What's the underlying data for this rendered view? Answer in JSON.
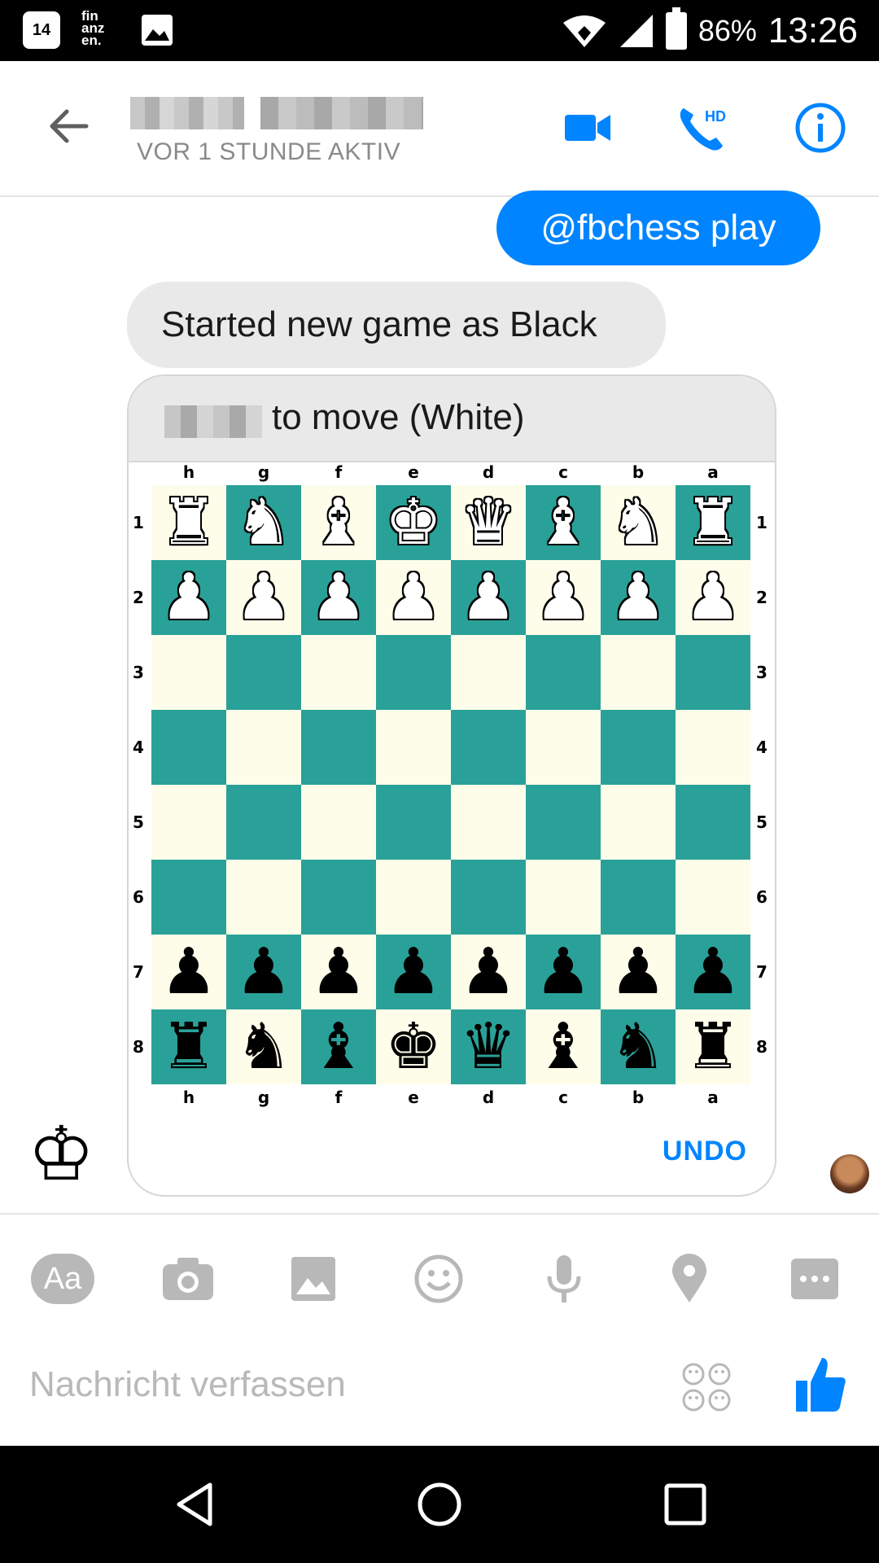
{
  "status_bar": {
    "battery": "86%",
    "time": "13:26",
    "notif_badge": "14",
    "finanzen_logo": "fin anz en."
  },
  "header": {
    "subtitle": "VOR 1 STUNDE AKTIV",
    "icons": [
      "back-arrow-icon",
      "video-call-icon",
      "hd-call-icon",
      "info-icon"
    ],
    "hd_label": "HD",
    "accent": "#0084ff"
  },
  "messages": {
    "outgoing": "@fbchess play",
    "incoming": "Started new game as Black"
  },
  "chess_card": {
    "to_move": "to move (White)",
    "undo": "UNDO",
    "files": [
      "h",
      "g",
      "f",
      "e",
      "d",
      "c",
      "b",
      "a"
    ],
    "ranks": [
      "1",
      "2",
      "3",
      "4",
      "5",
      "6",
      "7",
      "8"
    ],
    "board": [
      [
        "wR",
        "wN",
        "wB",
        "wK",
        "wQ",
        "wB",
        "wN",
        "wR"
      ],
      [
        "wP",
        "wP",
        "wP",
        "wP",
        "wP",
        "wP",
        "wP",
        "wP"
      ],
      [
        "",
        "",
        "",
        "",
        "",
        "",
        "",
        ""
      ],
      [
        "",
        "",
        "",
        "",
        "",
        "",
        "",
        ""
      ],
      [
        "",
        "",
        "",
        "",
        "",
        "",
        "",
        ""
      ],
      [
        "",
        "",
        "",
        "",
        "",
        "",
        "",
        ""
      ],
      [
        "bP",
        "bP",
        "bP",
        "bP",
        "bP",
        "bP",
        "bP",
        "bP"
      ],
      [
        "bR",
        "bN",
        "bB",
        "bK",
        "bQ",
        "bB",
        "bN",
        "bR"
      ]
    ],
    "light_color": "#fdfdea",
    "dark_color": "#2aa198"
  },
  "composer": {
    "placeholder": "Nachricht verfassen",
    "aa": "Aa",
    "tools": [
      "text-format-icon",
      "camera-icon",
      "gallery-icon",
      "emoji-icon",
      "microphone-icon",
      "location-icon",
      "more-icon"
    ]
  }
}
